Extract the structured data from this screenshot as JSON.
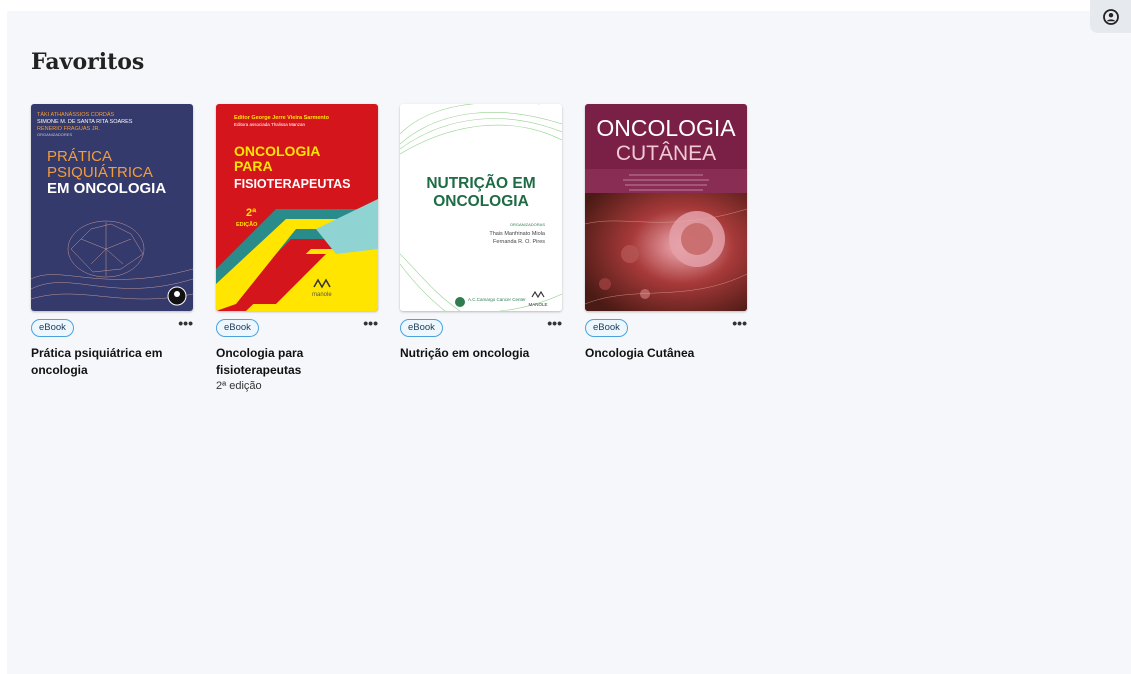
{
  "header": {
    "user_icon": "user-circle-icon"
  },
  "page": {
    "title": "Favoritos"
  },
  "books": [
    {
      "badge": "eBook",
      "title": "Prática psiquiátrica em oncologia",
      "edition": "",
      "cover": {
        "authors": [
          "TÁKI ATHANÁSSIOS CORDÁS",
          "SIMONE M. DE SANTA RITA SOARES",
          "RENERIO FRAGUAS JR."
        ],
        "role": "ORGANIZADORES",
        "title_lines": [
          "PRÁTICA",
          "PSIQUIÁTRICA",
          "EM ONCOLOGIA"
        ],
        "bg": "#343a6b",
        "accent": "#f39c3c"
      }
    },
    {
      "badge": "eBook",
      "title": "Oncologia para fisioterapeutas",
      "edition": "2ª edição",
      "cover": {
        "editor": "Editor George Jerre Vieira Sarmento",
        "assoc": "Editora associada Thalissa Manzan",
        "title_lines": [
          "ONCOLOGIA",
          "PARA",
          "FISIOTERAPEUTAS"
        ],
        "edition_mark": "2ª",
        "edition_word": "EDIÇÃO",
        "publisher": "manole",
        "bg": "#d4161c",
        "accent": "#ffe500"
      }
    },
    {
      "badge": "eBook",
      "title": "Nutrição em oncologia",
      "edition": "",
      "cover": {
        "title_lines": [
          "NUTRIÇÃO EM",
          "ONCOLOGIA"
        ],
        "role": "ORGANIZADORAS",
        "authors": [
          "Thais Manfrinato Miola",
          "Fernanda R. O. Pires"
        ],
        "logo": "A.C.Camargo Cancer Center",
        "publisher": "MANOLE",
        "bg": "#ffffff",
        "accent": "#2e7d4f"
      }
    },
    {
      "badge": "eBook",
      "title": "Oncologia Cutânea",
      "edition": "",
      "cover": {
        "title_lines": [
          "ONCOLOGIA",
          "CUTÂNEA"
        ],
        "bg": "#7a1f45",
        "accent": "#c86a6a"
      }
    }
  ]
}
